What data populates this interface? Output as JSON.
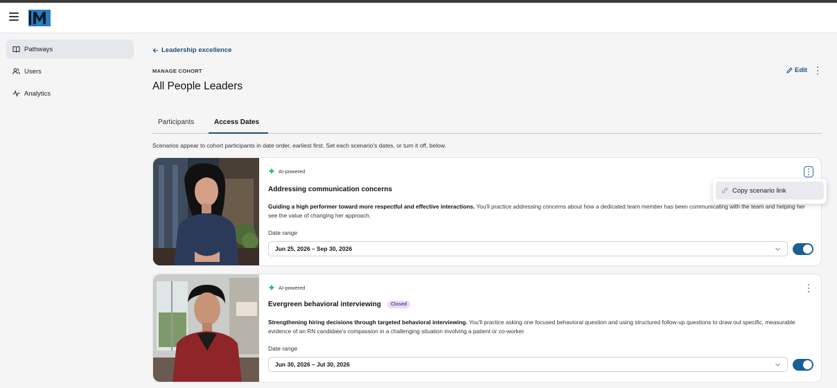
{
  "nav": {
    "items": [
      {
        "label": "Pathways",
        "icon": "book-icon"
      },
      {
        "label": "Users",
        "icon": "users-icon"
      },
      {
        "label": "Analytics",
        "icon": "activity-icon"
      }
    ]
  },
  "header": {
    "back_link": "Leadership excellence",
    "eyebrow": "MANAGE COHORT",
    "title": "All People Leaders",
    "edit_label": "Edit"
  },
  "tabs": [
    {
      "label": "Participants"
    },
    {
      "label": "Access Dates",
      "active": true
    }
  ],
  "intro": "Scenarios appear to cohort participants in date order, earliest first. Set each scenario's dates, or turn it off, below.",
  "scenarios": [
    {
      "tag": "AI-powered",
      "title": "Addressing communication concerns",
      "badge": "",
      "desc_bold": "Guiding a high performer toward more respectful and effective interactions.",
      "desc_rest": " You'll practice addressing concerns about how a dedicated team member has been communicating with the team and helping her see the value of changing her approach.",
      "date_label": "Date range",
      "date_value": "Jun 25, 2026 – Sep 30, 2026",
      "enabled": true
    },
    {
      "tag": "AI-powered",
      "title": "Evergreen behavioral interviewing",
      "badge": "Closed",
      "desc_bold": "Strengthening hiring decisions through targeted behavioral interviewing.",
      "desc_rest": " You'll practice asking one focused behavioral question and using structured follow-up questions to draw out specific, measurable evidence of an RN candidate's compassion in a challenging situation involving a patient or co-worker.",
      "date_label": "Date range",
      "date_value": "Jun 30, 2026 – Jul 30, 2026",
      "enabled": true
    }
  ],
  "menu": {
    "copy_link": "Copy scenario link"
  },
  "colors": {
    "accent": "#1b4f7a",
    "toggle_on": "#1b5f96",
    "badge_bg": "#e8dcf5",
    "badge_text": "#6a3e9e",
    "ai_spark": "#2bb98a"
  }
}
